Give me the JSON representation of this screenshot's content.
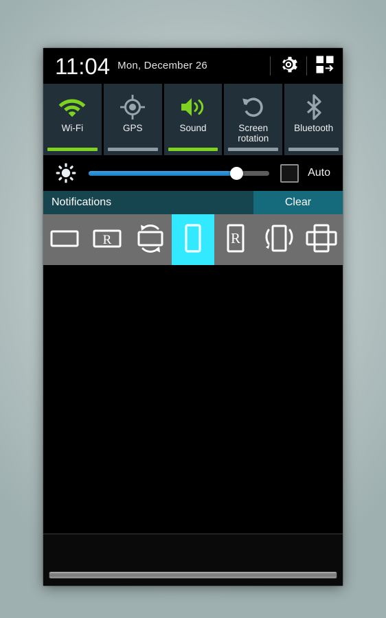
{
  "status_bar": {
    "time": "11:04",
    "date": "Mon, December 26",
    "settings_icon": "gear-icon",
    "quick_panel_icon": "grid-toggle-icon"
  },
  "quick_toggles": [
    {
      "label": "Wi-Fi",
      "icon": "wifi-icon",
      "state": "on"
    },
    {
      "label": "GPS",
      "icon": "gps-icon",
      "state": "off"
    },
    {
      "label": "Sound",
      "icon": "sound-icon",
      "state": "on"
    },
    {
      "label": "Screen\nrotation",
      "icon": "screen-rotation-icon",
      "state": "off"
    },
    {
      "label": "Bluetooth",
      "icon": "bluetooth-icon",
      "state": "off"
    }
  ],
  "brightness": {
    "icon": "brightness-sun-icon",
    "value": 82,
    "auto_label": "Auto",
    "auto_checked": false
  },
  "notifications": {
    "title": "Notifications",
    "clear_label": "Clear"
  },
  "orientation_strip": {
    "items": [
      {
        "icon": "landscape-icon",
        "selected": false
      },
      {
        "icon": "landscape-reverse-r-icon",
        "selected": false
      },
      {
        "icon": "landscape-rotate-icon",
        "selected": false
      },
      {
        "icon": "portrait-icon",
        "selected": true
      },
      {
        "icon": "portrait-reverse-r-icon",
        "selected": false
      },
      {
        "icon": "portrait-shake-icon",
        "selected": false
      },
      {
        "icon": "auto-rotate-icon",
        "selected": false
      }
    ]
  },
  "colors": {
    "accent_on": "#7ed321",
    "accent_off": "#8e9aa4",
    "tile_bg": "#22303a",
    "notif_bar": "#16444f",
    "clear_bg": "#156b7c",
    "selection": "#33e9ff",
    "slider_fill": "#1c7fc4",
    "strip_bg": "#6e6e6e"
  }
}
